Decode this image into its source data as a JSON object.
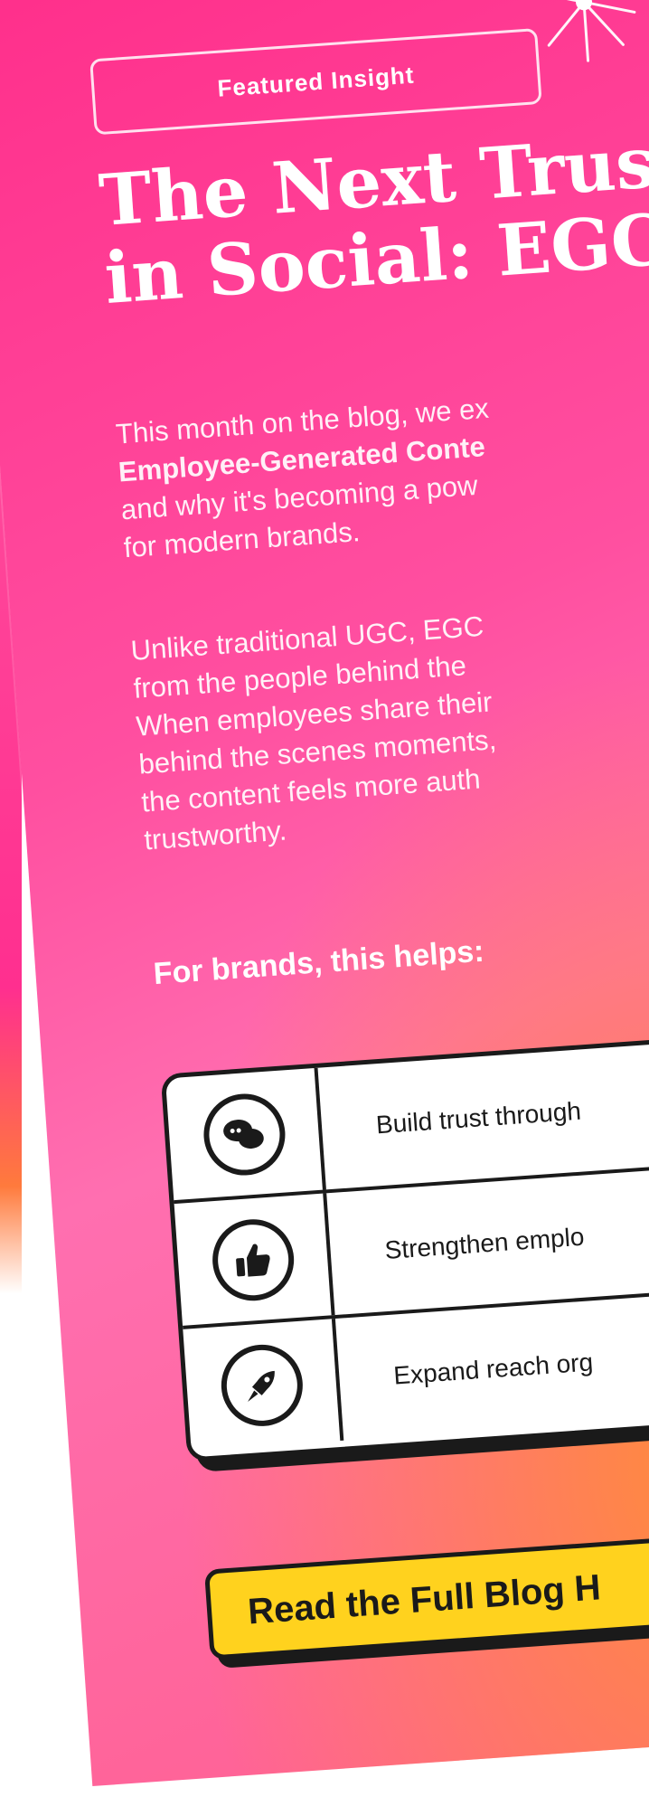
{
  "badge": {
    "label": "Featured Insight"
  },
  "title": {
    "line1": "The Next Trust",
    "line2": "in Social: EGC"
  },
  "intro": {
    "part1": "This month on the blog, we ex",
    "bold": "Employee-Generated Conte",
    "part2": "and why it's becoming a pow",
    "part3": "for modern brands."
  },
  "body": {
    "line1": "Unlike traditional UGC, EGC",
    "line2": "from the people behind the",
    "line3": "When employees share their",
    "line4": "behind the scenes moments,",
    "line5": "the content feels more auth",
    "line6": "trustworthy."
  },
  "helps_heading": "For brands, this helps:",
  "benefits": [
    {
      "icon": "chat-bubbles-icon",
      "text": "Build trust through"
    },
    {
      "icon": "thumbs-up-icon",
      "text": "Strengthen emplo"
    },
    {
      "icon": "rocket-icon",
      "text": "Expand reach org"
    }
  ],
  "cta": {
    "label": "Read the Full Blog H"
  },
  "colors": {
    "pink": "#ff2d8a",
    "orange": "#ff8a3d",
    "yellow": "#ffd21e",
    "ink": "#1a1a1a"
  }
}
